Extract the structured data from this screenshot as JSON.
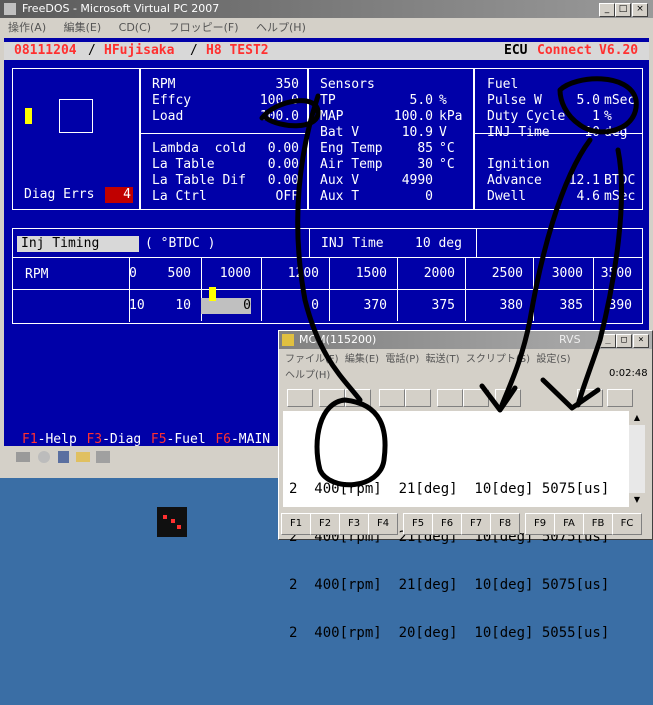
{
  "vpc": {
    "title": "FreeDOS - Microsoft Virtual PC 2007",
    "menu": [
      "操作(A)",
      "編集(E)",
      "CD(C)",
      "フロッピー(F)",
      "ヘルプ(H)"
    ]
  },
  "dos": {
    "header": {
      "date": "08111204",
      "sep1": "/",
      "user": "HFujisaka",
      "sep2": "/",
      "project": "H8 TEST2",
      "app1": "ECU",
      "app2": "Connect",
      "version": "V6.20"
    },
    "diag": {
      "label": "Diag Errs",
      "count": "4"
    },
    "engine": [
      {
        "label": "RPM",
        "value": "350"
      },
      {
        "label": "Effcy",
        "value": "100.0"
      },
      {
        "label": "Load",
        "value": "100.0"
      }
    ],
    "lambda": [
      {
        "label": "Lambda  cold",
        "value": "0.00"
      },
      {
        "label": "La Table",
        "value": "0.00"
      },
      {
        "label": "La Table Dif",
        "value": "0.00"
      },
      {
        "label": "La Ctrl",
        "value": "OFF"
      }
    ],
    "sensors": {
      "title": "Sensors",
      "rows": [
        {
          "label": "TP",
          "value": "5.0",
          "unit": "%"
        },
        {
          "label": "MAP",
          "value": "100.0",
          "unit": "kPa"
        },
        {
          "label": "Bat V",
          "value": "10.9",
          "unit": "V"
        },
        {
          "label": "Eng Temp",
          "value": "85",
          "unit": "°C"
        },
        {
          "label": "Air Temp",
          "value": "30",
          "unit": "°C"
        },
        {
          "label": "Aux V",
          "value": "4990",
          "unit": ""
        },
        {
          "label": "Aux T",
          "value": "0",
          "unit": ""
        }
      ]
    },
    "fuel": {
      "title": "Fuel",
      "rows": [
        {
          "label": "Pulse W",
          "value": "5.0",
          "unit": "mSec"
        },
        {
          "label": "Duty Cycle",
          "value": "1",
          "unit": "%"
        },
        {
          "label": "INJ Time",
          "value": "10",
          "unit": "deg"
        }
      ]
    },
    "ignition": {
      "title": "Ignition",
      "rows": [
        {
          "label": "Advance",
          "value": "12.1",
          "unit": "BTDC"
        },
        {
          "label": "Dwell",
          "value": "4.6",
          "unit": "mSec"
        }
      ]
    },
    "inj_table": {
      "title": "Inj Timing",
      "unit": "( °BTDC )",
      "inj_label": "INJ Time",
      "inj_value": "10 deg",
      "row_label": "RPM",
      "rpm": [
        "0",
        "500",
        "1000",
        "1200",
        "1500",
        "2000",
        "2500",
        "3000",
        "3500"
      ],
      "values": [
        "10",
        "10",
        "0",
        "0",
        "370",
        "375",
        "380",
        "385",
        "390"
      ]
    },
    "fkeys": [
      {
        "key": "F1",
        "label": "-Help"
      },
      {
        "key": "F3",
        "label": "-Diag"
      },
      {
        "key": "F5",
        "label": "-Fuel"
      },
      {
        "key": "F6",
        "label": "-MAIN"
      }
    ]
  },
  "mcm": {
    "title": "MCM(115200)",
    "title_right": "RVS",
    "menu": [
      "ファイル(F)",
      "編集(E)",
      "電話(P)",
      "転送(T)",
      "スクリプト(S)",
      "設定(S)"
    ],
    "menu2": "ヘルプ(H)",
    "clock": "0:02:48",
    "lines": [
      "2  400[rpm]  21[deg]  10[deg] 5075[us]",
      "2  400[rpm]  21[deg]  10[deg] 5075[us]",
      "2  400[rpm]  21[deg]  10[deg] 5075[us]",
      "2  400[rpm]  20[deg]  10[deg] 5055[us]"
    ],
    "fkeys": [
      "F1",
      "F2",
      "F3",
      "F4",
      "F5",
      "F6",
      "F7",
      "F8",
      "F9",
      "FA",
      "FB",
      "FC"
    ]
  },
  "colors": {
    "dos_bg": "#0000a8",
    "dos_red": "#ff3030",
    "desktop": "#3a6ea5",
    "annotation": "#000000"
  }
}
